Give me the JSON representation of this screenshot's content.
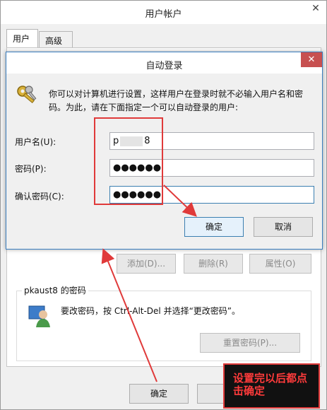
{
  "outer_window": {
    "title": "用户帐户",
    "close_glyph": "✕",
    "tabs": [
      {
        "label": "用户",
        "active": true
      },
      {
        "label": "高级",
        "active": false
      }
    ],
    "buttons": {
      "add": "添加(D)...",
      "remove": "删除(R)",
      "properties": "属性(O)"
    },
    "password_group": {
      "label": "pkaust8 的密码",
      "description": "要改密码，按 Ctrl-Alt-Del 并选择“更改密码”。",
      "reset_button": "重置密码(P)..."
    },
    "ok_button": "确定"
  },
  "dialog": {
    "title": "自动登录",
    "close_glyph": "✕",
    "description": "你可以对计算机进行设置，这样用户在登录时就不必输入用户名和密码。为此，请在下面指定一个可以自动登录的用户:",
    "fields": {
      "username_label": "用户名(U):",
      "username_prefix": "p",
      "username_suffix": "8",
      "password_label": "密码(P):",
      "password_value": "●●●●●●",
      "confirm_label": "确认密码(C):",
      "confirm_value": "●●●●●●"
    },
    "ok_button": "确定",
    "cancel_button": "取消"
  },
  "annotation": {
    "note": "设置完以后都点击确定",
    "color": "#e03a3a"
  },
  "icons": {
    "dialog_icon": "keys-icon",
    "user_icon": "user-image-icon"
  }
}
